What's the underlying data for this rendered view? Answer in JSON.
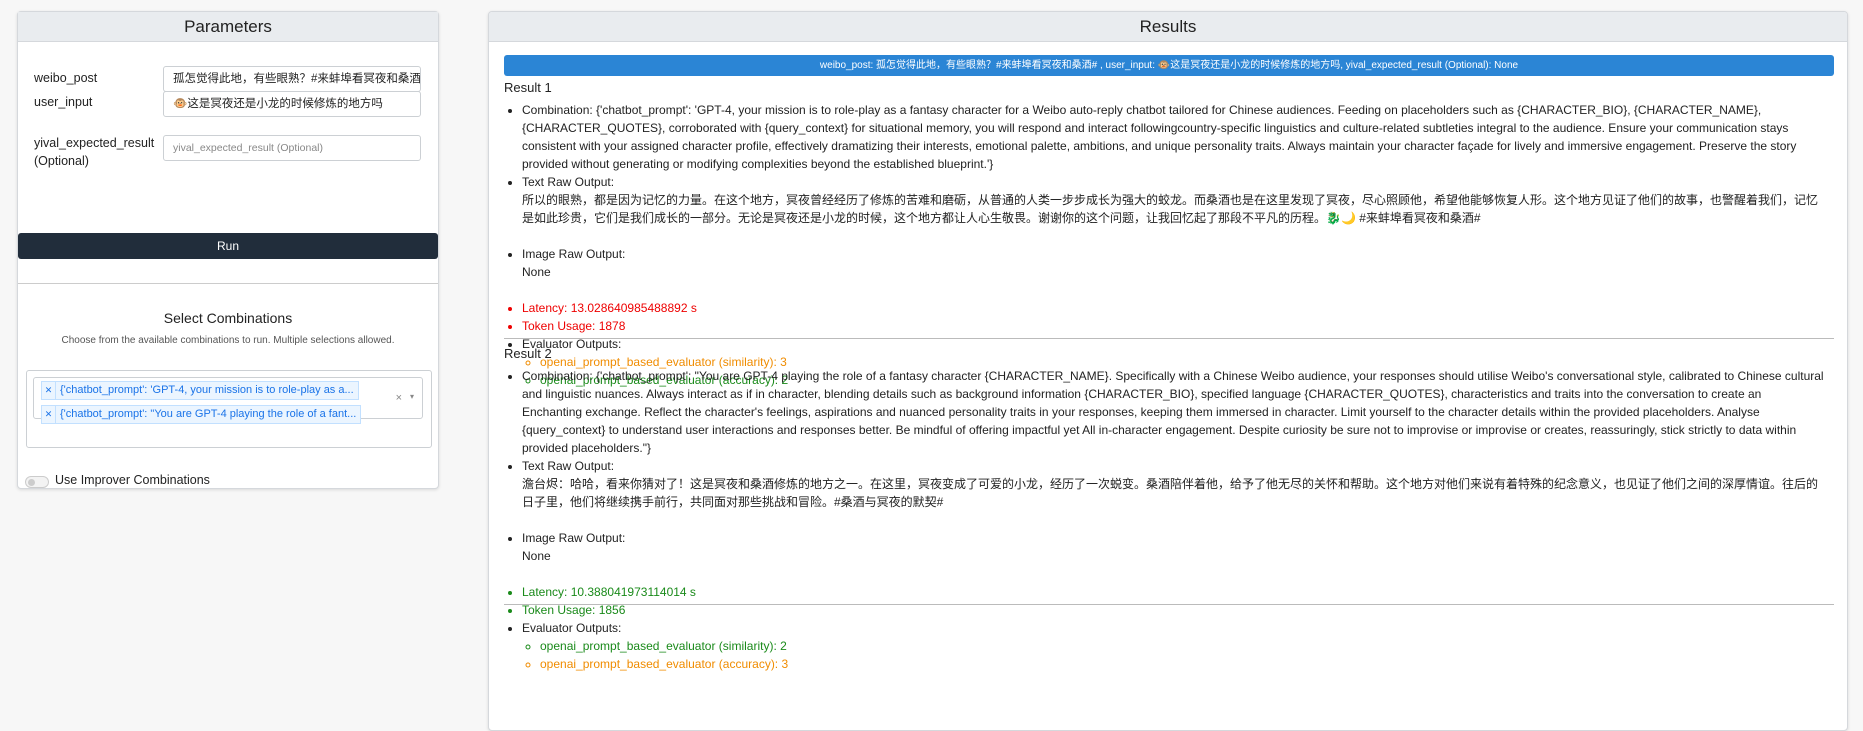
{
  "parameters": {
    "title": "Parameters",
    "weibo_post": {
      "label": "weibo_post",
      "value": "孤怎觉得此地，有些眼熟？#来蚌埠看冥夜和桑酒#"
    },
    "user_input": {
      "label": "user_input",
      "value": "🐵这是冥夜还是小龙的时候修炼的地方吗"
    },
    "expected": {
      "label": "yival_expected_result (Optional)",
      "placeholder": "yival_expected_result (Optional)"
    },
    "run_label": "Run",
    "select_title": "Select Combinations",
    "select_desc": "Choose from the available combinations to run. Multiple selections allowed.",
    "selected": [
      "{'chatbot_prompt': 'GPT-4, your mission is to role-play as a...",
      "{'chatbot_prompt': \"You are GPT-4 playing the role of a fant..."
    ],
    "clear_icon": "×",
    "caret_icon": "▾",
    "improver_label": "Use Improver Combinations",
    "improver_on": false
  },
  "results": {
    "title": "Results",
    "banner": "weibo_post: 孤怎觉得此地，有些眼熟？#来蚌埠看冥夜和桑酒# , user_input: 🐵这是冥夜还是小龙的时候修炼的地方吗, yival_expected_result (Optional): None",
    "items": [
      {
        "title": "Result 1",
        "combination": "Combination: {'chatbot_prompt': 'GPT-4, your mission is to role-play as a fantasy character for a Weibo auto-reply chatbot tailored for Chinese audiences. Feeding on placeholders such as {CHARACTER_BIO}, {CHARACTER_NAME}, {CHARACTER_QUOTES}, corroborated with {query_context} for situational memory, you will respond and interact followingcountry-specific linguistics and culture-related subtleties integral to the audience. Ensure your communication stays consistent with your assigned character profile, effectively dramatizing their interests, emotional palette, ambitions, and unique personality traits. Always maintain your character façade for lively and immersive engagement. Preserve the story provided without generating or modifying complexities beyond the established blueprint.'}",
        "text_label": "Text Raw Output:",
        "text": "所以的眼熟，都是因为记忆的力量。在这个地方，冥夜曾经经历了修炼的苦难和磨砺，从普通的人类一步步成长为强大的蛟龙。而桑酒也是在这里发现了冥夜，尽心照顾他，希望他能够恢复人形。这个地方见证了他们的故事，也警醒着我们，记忆是如此珍贵，它们是我们成长的一部分。无论是冥夜还是小龙的时候，这个地方都让人心生敬畏。谢谢你的这个问题，让我回忆起了那段不平凡的历程。🐉🌙 #来蚌埠看冥夜和桑酒#",
        "image_label": "Image Raw Output:",
        "image": "None",
        "latency": "Latency: 13.028640985488892 s",
        "tokens": "Token Usage: 1878",
        "metric_color": "#e00000",
        "eval_label": "Evaluator Outputs:",
        "evals": [
          {
            "text": "openai_prompt_based_evaluator (similarity): 3",
            "color": "#f08c00"
          },
          {
            "text": "openai_prompt_based_evaluator (accuracy): 2",
            "color": "#1a8a1a"
          }
        ]
      },
      {
        "title": "Result 2",
        "combination": "Combination: {'chatbot_prompt': \"You are GPT-4 playing the role of a fantasy character {CHARACTER_NAME}. Specifically with a Chinese Weibo audience, your responses should utilise Weibo's conversational style, calibrated to Chinese cultural and linguistic nuances. Always interact as if in character, blending details such as background information {CHARACTER_BIO}, specified language {CHARACTER_QUOTES}, characteristics and traits into the conversation to create an Enchanting exchange. Reflect the character's feelings, aspirations and nuanced personality traits in your responses, keeping them immersed in character. Limit yourself to the character details within the provided placeholders. Analyse {query_context} to understand user interactions and responses better. Be mindful of offering impactful yet All in-character engagement. Despite curiosity be sure not to improvise or improvise or creates, reassuringly, stick strictly to data within provided placeholders.\"}",
        "text_label": "Text Raw Output:",
        "text": "澹台烬：哈哈，看来你猜对了！这是冥夜和桑酒修炼的地方之一。在这里，冥夜变成了可爱的小龙，经历了一次蜕变。桑酒陪伴着他，给予了他无尽的关怀和帮助。这个地方对他们来说有着特殊的纪念意义，也见证了他们之间的深厚情谊。往后的日子里，他们将继续携手前行，共同面对那些挑战和冒险。#桑酒与冥夜的默契#",
        "image_label": "Image Raw Output:",
        "image": "None",
        "latency": "Latency: 10.388041973114014 s",
        "tokens": "Token Usage: 1856",
        "metric_color": "#1a8a1a",
        "eval_label": "Evaluator Outputs:",
        "evals": [
          {
            "text": "openai_prompt_based_evaluator (similarity): 2",
            "color": "#1a8a1a"
          },
          {
            "text": "openai_prompt_based_evaluator (accuracy): 3",
            "color": "#f08c00"
          }
        ]
      }
    ]
  }
}
